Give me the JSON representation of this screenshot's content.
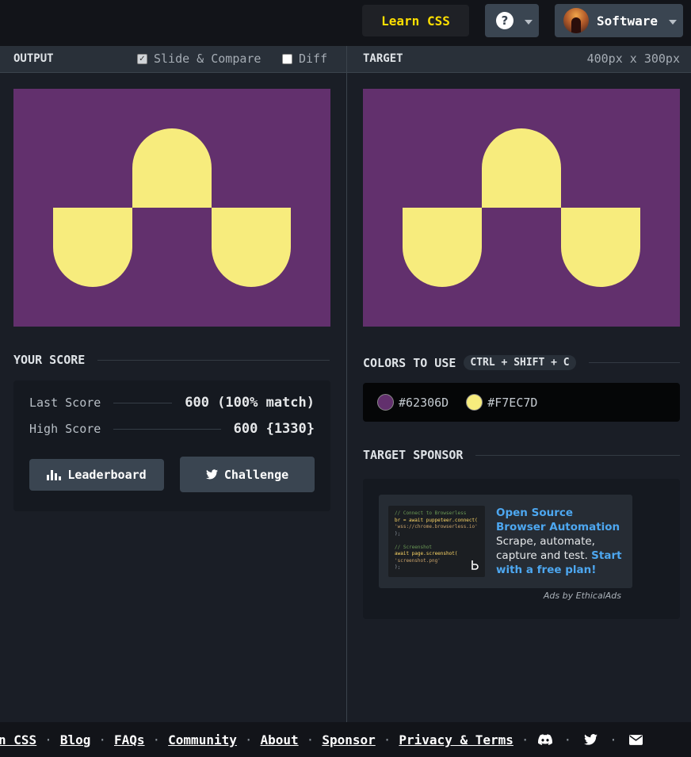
{
  "topbar": {
    "learn_label": "Learn CSS",
    "help_glyph": "?",
    "user_name": "Software"
  },
  "output_header": {
    "title": "OUTPUT",
    "slide_compare_label": "Slide & Compare",
    "slide_compare_checked": true,
    "diff_label": "Diff",
    "diff_checked": false
  },
  "target_header": {
    "title": "TARGET",
    "dimensions": "400px x 300px"
  },
  "score": {
    "heading": "YOUR SCORE",
    "last_label": "Last Score",
    "last_value": "600 (100% match)",
    "high_label": "High Score",
    "high_value": "600 {1330}",
    "leaderboard_label": "Leaderboard",
    "challenge_label": "Challenge"
  },
  "colors": {
    "heading": "COLORS TO USE",
    "shortcut": "CTRL + SHIFT + C",
    "items": [
      {
        "hex": "#62306D"
      },
      {
        "hex": "#F7EC7D"
      }
    ]
  },
  "sponsor": {
    "heading": "TARGET SPONSOR",
    "code_lines": [
      "// Connect to Browserless",
      "br = await puppeteer.connect(",
      "  'wss://chrome.browserless.io'",
      ");",
      "",
      "// Screenshot",
      "await page.screenshot(",
      "  'screenshot.png'",
      ");"
    ],
    "headline": "Open Source Browser Automation",
    "body": "Scrape, automate, capture and test.",
    "cta": "Start with a free plan!",
    "ads_by": "Ads by EthicalAds"
  },
  "footer": {
    "links": [
      "n CSS",
      "Blog",
      "FAQs",
      "Community",
      "About",
      "Sponsor",
      "Privacy & Terms"
    ],
    "separator": "·",
    "icons": [
      "discord-icon",
      "twitter-icon",
      "mail-icon"
    ]
  },
  "theme": {
    "background": "#1a1e26",
    "panel_header": "#293039",
    "accent_yellow": "#ffdf00",
    "link_blue": "#4da7f0",
    "button": "#3a4551"
  }
}
